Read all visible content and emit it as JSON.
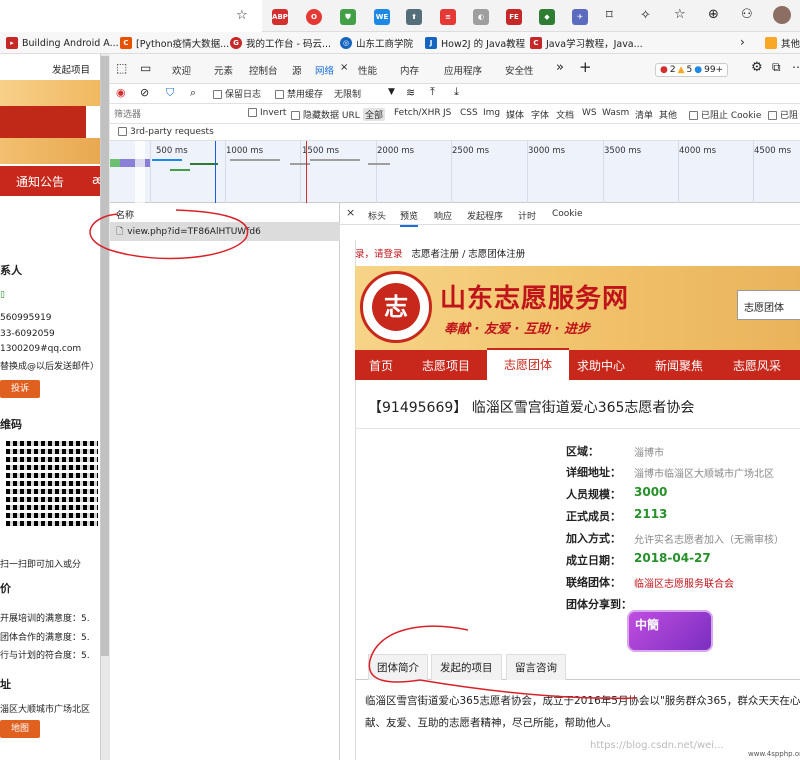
{
  "browser": {
    "extensions": [
      "ABP",
      "O",
      "shield",
      "WE",
      "⬆",
      "≡",
      "◐",
      "FE",
      "◆",
      "✈"
    ],
    "bookmarks": [
      {
        "label": "Building Android A...",
        "color": "#c62828"
      },
      {
        "label": "[Python疫情大数据...",
        "color": "#e65100"
      },
      {
        "label": "我的工作台 - 码云...",
        "color": "#c62828"
      },
      {
        "label": "山东工商学院",
        "color": "#1565c0"
      },
      {
        "label": "How2J 的 Java教程",
        "color": "#1565c0"
      },
      {
        "label": "Java学习教程，Java...",
        "color": "#c62828"
      },
      {
        "label": "其他",
        "color": "#f9a825"
      }
    ]
  },
  "left_page": {
    "top_link": "发起项目",
    "notice": "通知公告",
    "contact_head": "系人",
    "contact_lines": [
      "",
      "560995919",
      "33-6092059",
      "1300209#qq.com",
      "替换成@以后发送邮件）"
    ],
    "complain_btn": "投诉",
    "qr_head": "维码",
    "qr_caption": "扫一扫即可加入或分",
    "rating_head": "价",
    "ratings": [
      "开展培训的满意度：5.",
      "团体合作的满意度：5.",
      "行与计划的符合度：5."
    ],
    "address_head": "址",
    "address": "淄区大顺城市广场北区",
    "map_btn": "地图"
  },
  "devtools": {
    "tabs": [
      "欢迎",
      "元素",
      "控制台",
      "源",
      "网络",
      "性能",
      "内存",
      "应用程序",
      "安全性"
    ],
    "active_tab": "网络",
    "errors": "2",
    "warnings": "5",
    "info": "99+",
    "toolbar": {
      "preserve_log": "保留日志",
      "disable_cache": "禁用缓存",
      "throttle": "无限制"
    },
    "filter": {
      "placeholder": "筛选器",
      "invert": "Invert",
      "hide_data_urls": "隐藏数据 URL",
      "types": [
        "全部",
        "Fetch/XHR",
        "JS",
        "CSS",
        "Img",
        "媒体",
        "字体",
        "文档",
        "WS",
        "Wasm",
        "清单",
        "其他"
      ],
      "blocked_cookies": "已阻止 Cookie",
      "blocked_requests": "已阻"
    },
    "third_party": "3rd-party requests",
    "timeline_labels": [
      "500 ms",
      "1000 ms",
      "1500 ms",
      "2000 ms",
      "2500 ms",
      "3000 ms",
      "3500 ms",
      "4000 ms",
      "4500 ms"
    ],
    "names_header": "名称",
    "request_name": "view.php?id=TF86AlHTUWfd6",
    "preview_tabs": [
      "标头",
      "预览",
      "响应",
      "发起程序",
      "计时",
      "Cookie"
    ],
    "active_preview_tab": "预览"
  },
  "preview": {
    "crumb_login": "录，请登录",
    "crumb_path": "志愿者注册 / 志愿团体注册",
    "site_title": "山东志愿服务网",
    "slogan": "奉献 · 友爱 · 互助 · 进步",
    "logo_char": "志",
    "search_select": "志愿团体",
    "nav": [
      "首页",
      "志愿项目",
      "志愿团体",
      "求助中心",
      "新闻聚焦",
      "志愿风采"
    ],
    "active_nav": "志愿团体",
    "org_title": "【91495669】 临淄区雪宫街道爱心365志愿者协会",
    "info": [
      {
        "k": "区域：",
        "v": "淄博市",
        "style": "gray"
      },
      {
        "k": "详细地址：",
        "v": "淄博市临淄区大顺城市广场北区",
        "style": "gray"
      },
      {
        "k": "人员规模：",
        "v": "3000",
        "style": "green"
      },
      {
        "k": "正式成员：",
        "v": "2113",
        "style": "green"
      },
      {
        "k": "加入方式：",
        "v": "允许实名志愿者加入（无需审核）",
        "style": "gray"
      },
      {
        "k": "成立日期：",
        "v": "2018-04-27",
        "style": "green"
      },
      {
        "k": "联络团体：",
        "v": "临淄区志愿服务联合会",
        "style": "red"
      },
      {
        "k": "团体分享到：",
        "v": "",
        "style": "gray"
      }
    ],
    "share_label": "中簡",
    "bottom_tabs": [
      "团体简介",
      "发起的项目",
      "留言咨询"
    ],
    "desc_line1": "临淄区雪宫街道爱心365志愿者协会，成立于2016年5月协会以\"服务群众365，群众天天在心中",
    "desc_line2": "献、友爱、互助的志愿者精神，尽己所能，帮助他人。",
    "watermark": "https://blog.csdn.net/wei...",
    "watermark2": "www.4spphp.online"
  }
}
